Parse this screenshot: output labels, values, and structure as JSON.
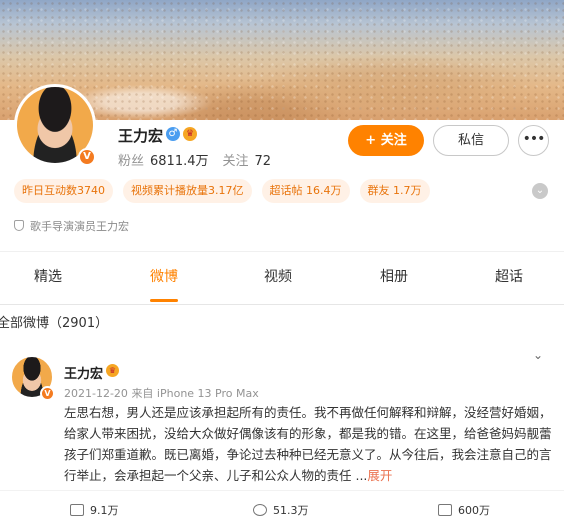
{
  "profile": {
    "name": "王力宏",
    "gender_icon": "male-icon",
    "vip_icon": "vip-crown-icon",
    "verified_badge": "V",
    "stats": {
      "fans_label": "粉丝",
      "fans_value": "6811.4万",
      "follow_label": "关注",
      "follow_value": "72"
    },
    "buttons": {
      "follow": "+ 关注",
      "message": "私信",
      "more": "•••"
    },
    "tags": [
      "昨日互动数3740",
      "视频累计播放量3.17亿",
      "超话帖 16.4万",
      "群友 1.7万"
    ],
    "description": "歌手导演演员王力宏"
  },
  "tabs": [
    {
      "label": "精选"
    },
    {
      "label": "微博"
    },
    {
      "label": "视频"
    },
    {
      "label": "相册"
    },
    {
      "label": "超话"
    }
  ],
  "feed": {
    "all_count": "全部微博（2901）",
    "post": {
      "author": "王力宏",
      "date": "2021-12-20",
      "source": "来自 iPhone 13 Pro Max",
      "text": "左思右想，男人还是应该承担起所有的责任。我不再做任何解释和辩解，没经营好婚姻，给家人带来困扰，没给大众做好偶像该有的形象，都是我的错。在这里，给爸爸妈妈靓蕾孩子们郑重道歉。既已离婚，争论过去种种已经无意义了。从今往后，我会注意自己的言行举止，会承担起一个父亲、儿子和公众人物的责任 ...",
      "expand_label": "展开",
      "actions": {
        "repost": "9.1万",
        "comment": "51.3万",
        "like": "600万"
      }
    }
  },
  "colors": {
    "accent": "#ff8200",
    "tag_bg": "#fff1e6",
    "tag_text": "#e8730a"
  }
}
